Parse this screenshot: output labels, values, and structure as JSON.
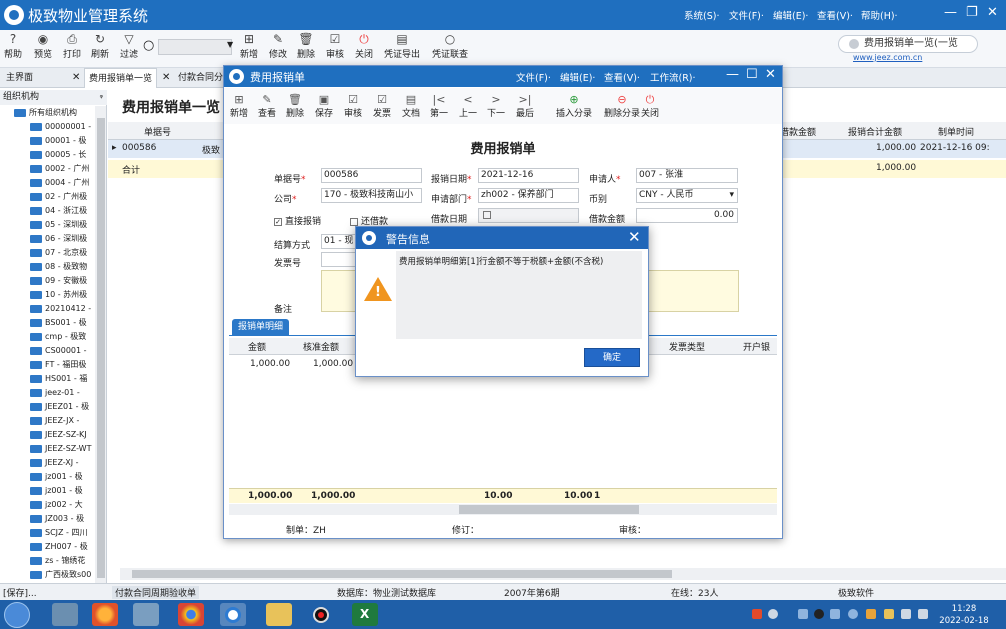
{
  "app": {
    "title": "极致物业管理系统",
    "menus": [
      "系统(S)·",
      "文件(F)·",
      "编辑(E)·",
      "查看(V)·",
      "帮助(H)·"
    ]
  },
  "toolbar": {
    "left_buttons": [
      {
        "label": "帮助",
        "icon": "help-icon",
        "glyph": "?"
      },
      {
        "label": "预览",
        "icon": "eye-icon",
        "glyph": "◉"
      },
      {
        "label": "打印",
        "icon": "printer-icon",
        "glyph": "⎙"
      },
      {
        "label": "刷新",
        "icon": "refresh-icon",
        "glyph": "↻"
      },
      {
        "label": "过滤",
        "icon": "filter-icon",
        "glyph": "▽"
      }
    ],
    "search_placeholder": "",
    "right_buttons": [
      {
        "label": "新增",
        "icon": "add-icon",
        "glyph": "⊞"
      },
      {
        "label": "修改",
        "icon": "edit-icon",
        "glyph": "✎"
      },
      {
        "label": "删除",
        "icon": "trash-icon",
        "glyph": "🗑"
      },
      {
        "label": "审核",
        "icon": "audit-icon",
        "glyph": "☑"
      },
      {
        "label": "关闭",
        "icon": "power-icon",
        "glyph": "⏻"
      },
      {
        "label": "凭证导出",
        "icon": "export-icon",
        "glyph": "▤"
      },
      {
        "label": "凭证联查",
        "icon": "search-icon",
        "glyph": "○"
      }
    ],
    "quick_search": "费用报销单一览(一览",
    "website": "www.jeez.com.cn"
  },
  "tabs": [
    {
      "label": "主界面",
      "closable": true
    },
    {
      "label": "费用报销单一览",
      "closable": true
    },
    {
      "label": "付款合同分",
      "closable": false
    }
  ],
  "tree": {
    "header": "组织机构",
    "pin": "ᵠ",
    "root": "所有组织机构",
    "items": [
      "00000001 -",
      "00001 - 极",
      "00005 - 长",
      "0002 - 广州",
      "0004 - 广州",
      "02 - 广州极",
      "04 - 浙江极",
      "05 - 深圳极",
      "06 - 深圳极",
      "07 - 北京极",
      "08 - 极致物",
      "09 - 安徽极",
      "10 - 苏州极",
      "20210412 -",
      "BS001 - 极",
      "cmp - 极致",
      "CS00001 -",
      "FT - 福田极",
      "HS001 - 福",
      "jeez-01 -",
      "JEEZ01 - 极",
      "JEEZ-JX -",
      "JEEZ-SZ-KJ",
      "JEEZ-SZ-WT",
      "JEEZ-XJ -",
      "jz001 - 极",
      "jz001 - 极",
      "jz002 - 大",
      "JZ003 - 极",
      "SCJZ - 四川",
      "ZH007 - 极",
      "zs - 锦绣花",
      "广西极致s00"
    ]
  },
  "list": {
    "title": "费用报销单一览",
    "headers": {
      "no": "单据号",
      "loan_amount": "借款金额",
      "total": "报销合计金额",
      "time": "制单时间"
    },
    "rows": [
      {
        "no": "000586",
        "desc": "极致",
        "total": "1,000.00",
        "time": "2021-12-16 09:"
      }
    ],
    "sum_label": "合计",
    "sum_total": "1,000.00"
  },
  "status": {
    "left": "[保存]...",
    "task": "付款合同周期验收单",
    "db": "数据库：物业测试数据库",
    "period": "2007年第6期",
    "online": "在线：23人",
    "company": "极致软件"
  },
  "taskbar": {
    "time": "11:28",
    "date": "2022-02-18"
  },
  "dialog": {
    "title": "费用报销单",
    "menus": [
      "文件(F)·",
      "编辑(E)·",
      "查看(V)·",
      "工作流(R)·"
    ],
    "toolbar": [
      {
        "label": "新增",
        "icon": "add-icon",
        "glyph": "⊞"
      },
      {
        "label": "查看",
        "icon": "view-icon",
        "glyph": "✎"
      },
      {
        "label": "删除",
        "icon": "trash-icon",
        "glyph": "🗑"
      },
      {
        "label": "保存",
        "icon": "save-icon",
        "glyph": "▣"
      },
      {
        "label": "审核",
        "icon": "audit-icon",
        "glyph": "☑"
      },
      {
        "label": "发票",
        "icon": "invoice-icon",
        "glyph": "☑"
      },
      {
        "label": "文档",
        "icon": "doc-icon",
        "glyph": "▤"
      },
      {
        "label": "第一",
        "icon": "first-icon",
        "glyph": "|<"
      },
      {
        "label": "上一",
        "icon": "prev-icon",
        "glyph": "<"
      },
      {
        "label": "下一",
        "icon": "next-icon",
        "glyph": ">"
      },
      {
        "label": "最后",
        "icon": "last-icon",
        "glyph": ">|"
      },
      {
        "label": "插入分录",
        "icon": "insert-row-icon",
        "glyph": "⊕"
      },
      {
        "label": "删除分录",
        "icon": "delete-row-icon",
        "glyph": "⊖"
      },
      {
        "label": "关闭",
        "icon": "power-icon",
        "glyph": "⏻"
      }
    ],
    "form_title": "费用报销单",
    "fields": {
      "bill_no_label": "单据号",
      "bill_no": "000586",
      "date_label": "报销日期",
      "date": "2021-12-16",
      "applicant_label": "申请人",
      "applicant": "007 - 张淮",
      "company_label": "公司",
      "company": "170 - 极致科技南山小",
      "dept_label": "申请部门",
      "dept": "zh002 - 保养部门",
      "currency_label": "币别",
      "currency": "CNY - 人民币",
      "direct_label": "直接报销",
      "repay_label": "还借款",
      "loan_date_label": "借款日期",
      "loan_amount_label": "借款金额",
      "loan_amount": "0.00",
      "settle_label": "结算方式",
      "settle": "01 - 现",
      "invoice_label": "发票号",
      "memo_label": "备注"
    },
    "detail_tab": "报销单明细",
    "detail_headers": {
      "amount": "金额",
      "approved": "核准金额",
      "inv_type": "发票类型",
      "bank": "开户银行"
    },
    "detail_row": {
      "amount": "1,000.00",
      "approved": "1,000.00"
    },
    "detail_sum": {
      "amount": "1,000.00",
      "approved": "1,000.00",
      "tax": "10.00",
      "tax2": "10.00",
      "n": "1"
    },
    "footer": {
      "maker": "制单：ZH",
      "modify": "修订：",
      "audit": "审核："
    }
  },
  "alert": {
    "title": "警告信息",
    "message": "费用报销单明细第[1]行金额不等于税额+金额(不含税)",
    "ok": "确定"
  },
  "colors": {
    "accent": "#1f6fbf",
    "warning": "#f0951f",
    "sum_bg": "#fff9d6"
  }
}
